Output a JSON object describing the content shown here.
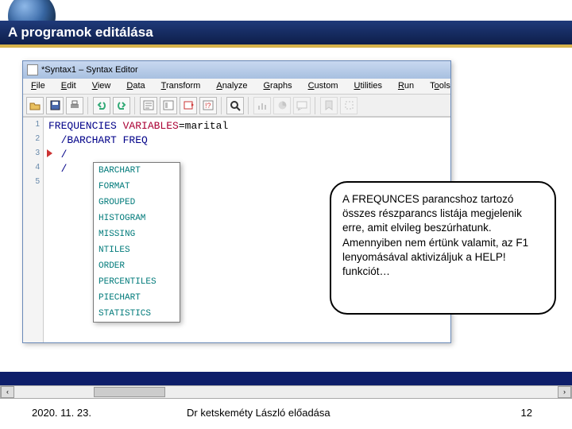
{
  "slide": {
    "title": "A programok  editálása",
    "footer": {
      "date": "2020. 11. 23.",
      "mid": "Dr ketskeméty László előadása",
      "num": "12"
    }
  },
  "window": {
    "title": "*Syntax1 – Syntax Editor",
    "menus": [
      "File",
      "Edit",
      "View",
      "Data",
      "Transform",
      "Analyze",
      "Graphs",
      "Custom",
      "Utilities",
      "Run",
      "Tools"
    ],
    "gutter": [
      "1",
      "2",
      "3",
      "4",
      "5"
    ],
    "code": {
      "l1_cmd": "FREQUENCIES ",
      "l1_kw": "VARIABLES",
      "l1_rest": "=marital",
      "l2": "  /BARCHART FREQ",
      "l3": "  /",
      "l4": "  /"
    },
    "autocomplete": [
      "BARCHART",
      "FORMAT",
      "GROUPED",
      "HISTOGRAM",
      "MISSING",
      "NTILES",
      "ORDER",
      "PERCENTILES",
      "PIECHART",
      "STATISTICS"
    ]
  },
  "callout": "A FREQUNCES parancshoz tartozó összes részparancs listája megjelenik erre, amit elvileg beszúrhatunk. Amennyiben nem értünk valamit, az F1 lenyomásával aktivizáljuk a HELP! funkciót…"
}
